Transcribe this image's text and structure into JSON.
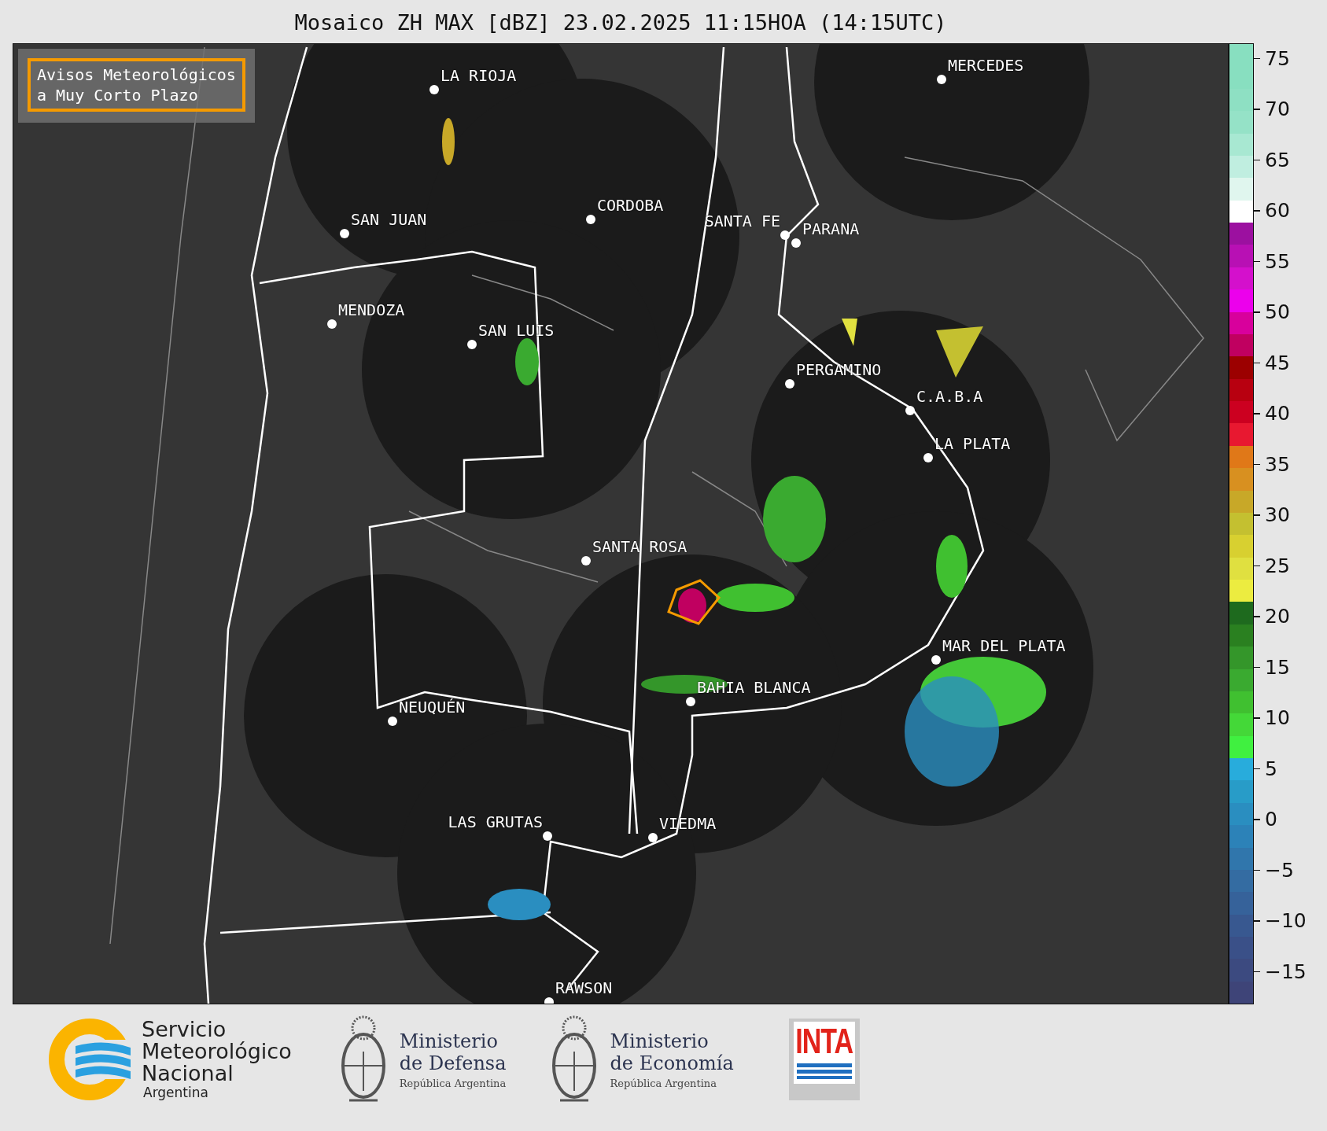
{
  "title": "Mosaico ZH MAX [dBZ] 23.02.2025 11:15HOA (14:15UTC)",
  "alert_legend": {
    "label": "Avisos Meteorológicos\na Muy Corto Plazo"
  },
  "cities": [
    {
      "name": "LA RIOJA"
    },
    {
      "name": "MERCEDES"
    },
    {
      "name": "SAN JUAN"
    },
    {
      "name": "CORDOBA"
    },
    {
      "name": "SANTA FE"
    },
    {
      "name": "PARANA"
    },
    {
      "name": "MENDOZA"
    },
    {
      "name": "SAN LUIS"
    },
    {
      "name": "PERGAMINO"
    },
    {
      "name": "C.A.B.A"
    },
    {
      "name": "LA PLATA"
    },
    {
      "name": "SANTA ROSA"
    },
    {
      "name": "MAR DEL PLATA"
    },
    {
      "name": "BAHIA BLANCA"
    },
    {
      "name": "NEUQUÉN"
    },
    {
      "name": "LAS GRUTAS"
    },
    {
      "name": "VIEDMA"
    },
    {
      "name": "RAWSON"
    }
  ],
  "colorbar": {
    "ticks": [
      "75",
      "70",
      "65",
      "60",
      "55",
      "50",
      "45",
      "40",
      "35",
      "30",
      "25",
      "20",
      "15",
      "10",
      "5",
      "0",
      "−5",
      "−10",
      "−15"
    ],
    "segments": [
      {
        "color": "#88dfc0"
      },
      {
        "color": "#88dfc0"
      },
      {
        "color": "#8ee0c3"
      },
      {
        "color": "#95e2c7"
      },
      {
        "color": "#a8e8d2"
      },
      {
        "color": "#c0eee0"
      },
      {
        "color": "#e0f6ee"
      },
      {
        "color": "#ffffff"
      },
      {
        "color": "#9c10a0"
      },
      {
        "color": "#b810b4"
      },
      {
        "color": "#d410cc"
      },
      {
        "color": "#ec00ec"
      },
      {
        "color": "#d8009c"
      },
      {
        "color": "#c00060"
      },
      {
        "color": "#9c0000"
      },
      {
        "color": "#b80010"
      },
      {
        "color": "#cc0020"
      },
      {
        "color": "#e81830"
      },
      {
        "color": "#e07818"
      },
      {
        "color": "#d89020"
      },
      {
        "color": "#c8a828"
      },
      {
        "color": "#c4c030"
      },
      {
        "color": "#d8d030"
      },
      {
        "color": "#e0e040"
      },
      {
        "color": "#ecec40"
      },
      {
        "color": "#1e6a1e"
      },
      {
        "color": "#2a8020"
      },
      {
        "color": "#34962a"
      },
      {
        "color": "#3aaa30"
      },
      {
        "color": "#40c030"
      },
      {
        "color": "#44d838"
      },
      {
        "color": "#40f040"
      },
      {
        "color": "#28acdc"
      },
      {
        "color": "#289cc8"
      },
      {
        "color": "#2a8ec0"
      },
      {
        "color": "#2c82b8"
      },
      {
        "color": "#3076ac"
      },
      {
        "color": "#346ca2"
      },
      {
        "color": "#36629a"
      },
      {
        "color": "#385890"
      },
      {
        "color": "#3a5088"
      },
      {
        "color": "#3c4a80"
      },
      {
        "color": "#3e4478"
      }
    ]
  },
  "logos": {
    "smn": {
      "lines": [
        "Servicio",
        "Meteorológico",
        "Nacional"
      ],
      "country": "Argentina"
    },
    "ministries": [
      {
        "line1": "Ministerio",
        "line2": "de Defensa",
        "country": "República Argentina"
      },
      {
        "line1": "Ministerio",
        "line2": "de Economía",
        "country": "República Argentina"
      }
    ],
    "inta": {
      "label": "INTA"
    }
  }
}
